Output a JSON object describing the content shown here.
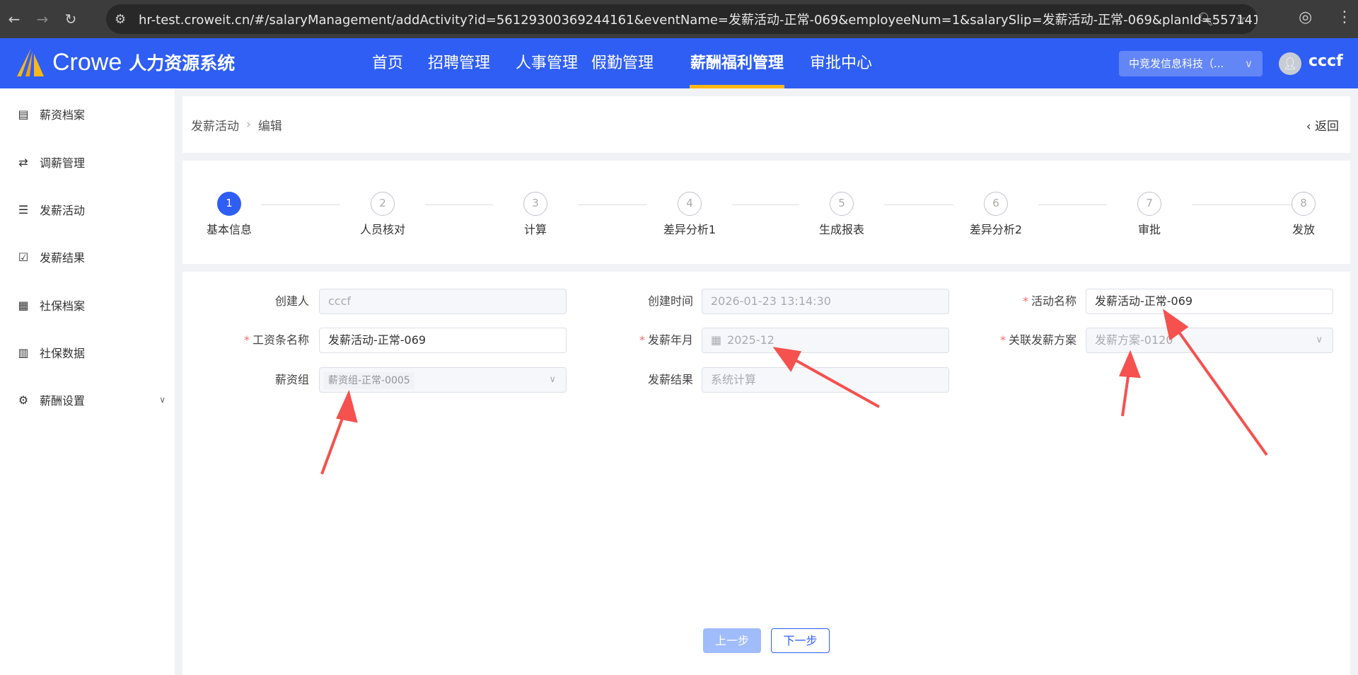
{
  "browser": {
    "url": "hr-test.croweit.cn/#/salaryManagement/addActivity?id=56129300369244161&eventName=发薪活动-正常-069&employeeNum=1&salarySlip=发薪活动-正常-069&planId=557141244..."
  },
  "header": {
    "brand": "Crowe",
    "system": "人力资源系统",
    "nav": [
      "首页",
      "招聘管理",
      "人事管理",
      "假勤管理",
      "薪酬福利管理",
      "审批中心"
    ],
    "active": "薪酬福利管理",
    "company": "中竞发信息科技（...",
    "user": "cccf",
    "accent": "#2f5ef5"
  },
  "sidebar": {
    "items": [
      {
        "label": "薪资档案",
        "icon": "file-icon"
      },
      {
        "label": "调薪管理",
        "icon": "exchange-icon"
      },
      {
        "label": "发薪活动",
        "icon": "list-icon"
      },
      {
        "label": "发薪结果",
        "icon": "clipboard-check-icon"
      },
      {
        "label": "社保档案",
        "icon": "grid-icon"
      },
      {
        "label": "社保数据",
        "icon": "bar-chart-icon"
      },
      {
        "label": "薪酬设置",
        "icon": "gear-icon"
      }
    ]
  },
  "breadcrumb": {
    "parent": "发薪活动",
    "current": "编辑",
    "back": "返回"
  },
  "steps": [
    {
      "n": "1",
      "label": "基本信息"
    },
    {
      "n": "2",
      "label": "人员核对"
    },
    {
      "n": "3",
      "label": "计算"
    },
    {
      "n": "4",
      "label": "差异分析1"
    },
    {
      "n": "5",
      "label": "生成报表"
    },
    {
      "n": "6",
      "label": "差异分析2"
    },
    {
      "n": "7",
      "label": "审批"
    },
    {
      "n": "8",
      "label": "发放"
    }
  ],
  "form": {
    "creator": {
      "label": "创建人",
      "value": "cccf"
    },
    "created_time": {
      "label": "创建时间",
      "value": "2026-01-23 13:14:30"
    },
    "activity_name": {
      "label": "活动名称",
      "value": "发薪活动-正常-069"
    },
    "slip_name": {
      "label": "工资条名称",
      "value": "发薪活动-正常-069"
    },
    "pay_month": {
      "label": "发薪年月",
      "value": "2025-12"
    },
    "plan": {
      "label": "关联发薪方案",
      "value": "发薪方案-0120"
    },
    "group": {
      "label": "薪资组",
      "value": "薪资组-正常-0005"
    },
    "result": {
      "label": "发薪结果",
      "value": "系统计算"
    }
  },
  "buttons": {
    "prev": "上一步",
    "next": "下一步"
  }
}
